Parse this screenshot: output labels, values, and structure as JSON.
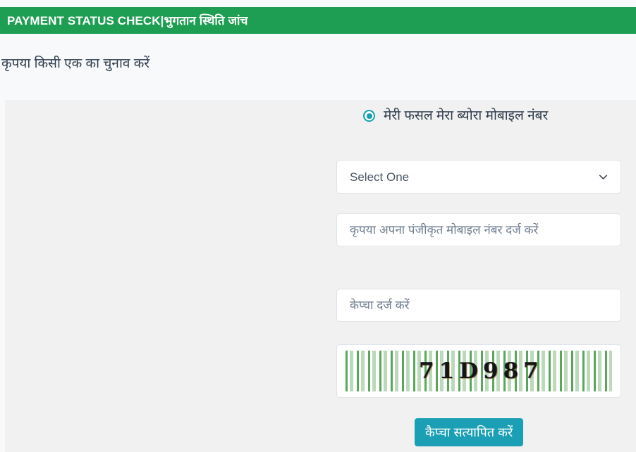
{
  "header": {
    "title": "PAYMENT STATUS CHECK|भुगतान स्थिति जांच",
    "bar_color": "#1e9e52"
  },
  "page": {
    "subtitle": "कृपया किसी एक का चुनाव करें",
    "panel_color": "#f1f1f1",
    "background_color": "#f7f9fb"
  },
  "form": {
    "radio": {
      "label": "मेरी फसल मेरा ब्योरा मोबाइल नंबर",
      "selected": "true",
      "accent_color": "#15a0ae"
    },
    "select": {
      "value": "Select One",
      "icon": "chevron-down-icon"
    },
    "mobile_input": {
      "value": "",
      "placeholder": "कृपया अपना पंजीकृत मोबाइल नंबर दर्ज करें"
    },
    "captcha_input": {
      "value": "",
      "placeholder": "केप्चा दर्ज करें"
    },
    "captcha_image": {
      "text": "71D987",
      "pattern_color": "#5aa75a"
    },
    "verify_button": {
      "label": "कैप्चा सत्यापित करें",
      "color": "#1b9fb5"
    }
  }
}
